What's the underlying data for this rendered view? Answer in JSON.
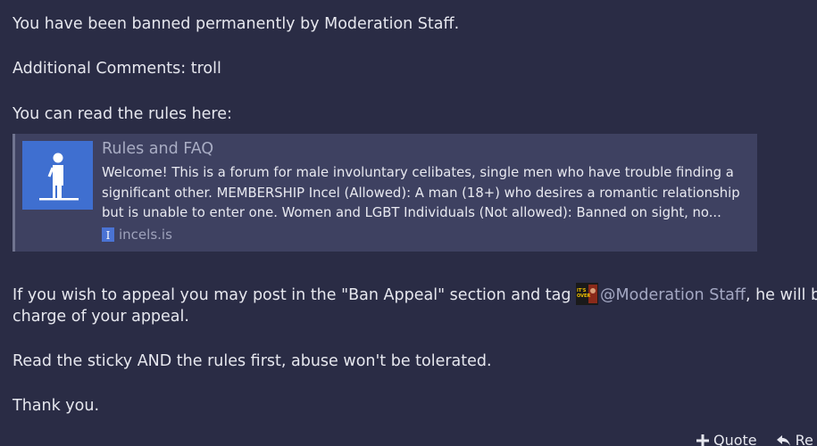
{
  "message": {
    "line1": "You have been banned permanently by Moderation Staff.",
    "line2": "Additional Comments: troll",
    "line3": "You can read the rules here:",
    "appeal_before": "If you wish to appeal you may post in the \"Ban Appeal\" section and tag ",
    "mention": "@Moderation Staff",
    "appeal_after": ", he will be in",
    "appeal_line2": "charge of your appeal.",
    "line5": "Read the sticky AND the rules first, abuse won't be tolerated.",
    "line6": "Thank you."
  },
  "unfurl": {
    "title": "Rules and FAQ",
    "description": "Welcome! This is a forum for male involuntary celibates, single men who have trouble finding a significant other. MEMBERSHIP Incel (Allowed): A man (18+) who desires a romantic relationship but is unable to enter one. Women and LGBT Individuals (Not allowed): Banned on sight, no...",
    "domain": "incels.is",
    "favicon_letter": "I",
    "thumb_icon": "standing-figure-icon"
  },
  "mention_avatar": {
    "text": "IT'S OVER"
  },
  "footer": {
    "quote_label": "Quote",
    "reply_label": "Re"
  },
  "colors": {
    "background": "#2a2c45",
    "unfurl_bg": "#3e4161",
    "accent_blue": "#3f6fd0"
  }
}
